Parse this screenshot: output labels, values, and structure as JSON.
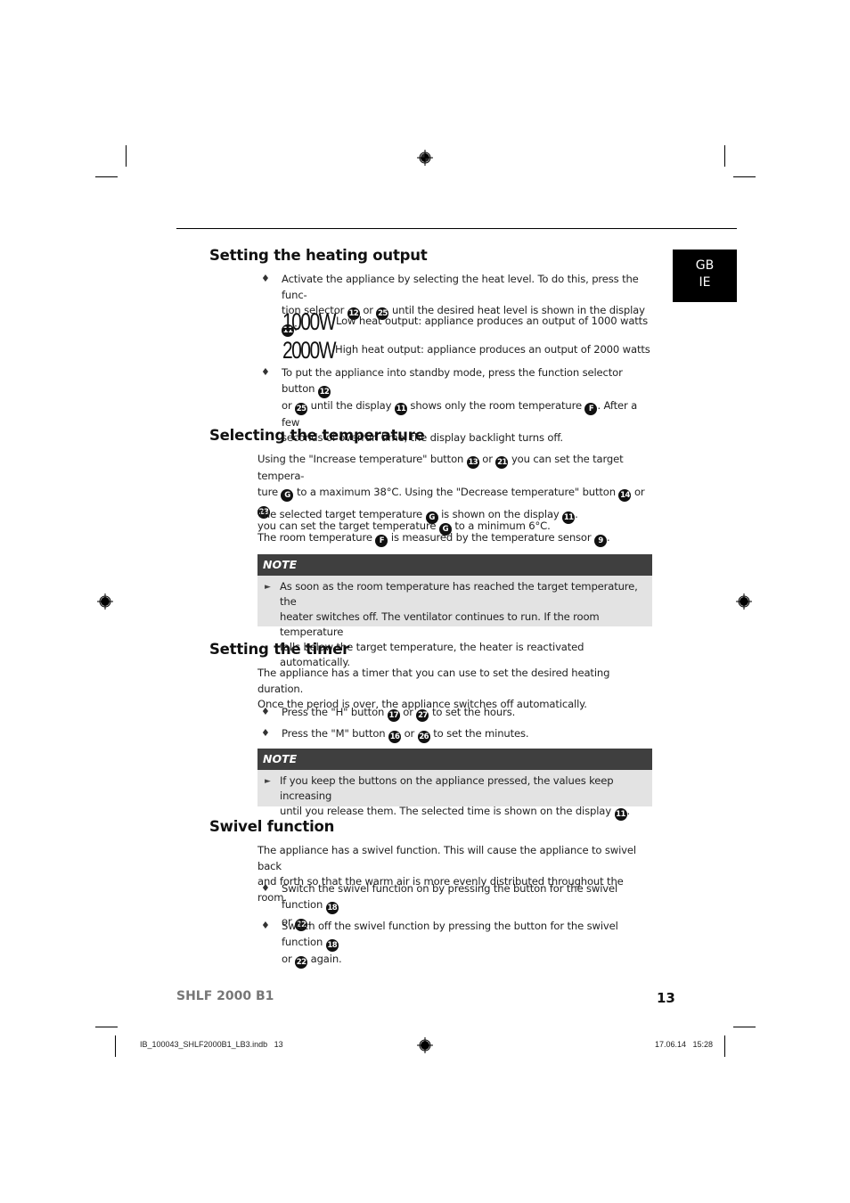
{
  "language_tab": {
    "line1": "GB",
    "line2": "IE"
  },
  "sections": {
    "heating": {
      "title": "Setting the heating output",
      "b1_a": "Activate the appliance by selecting the heat level. To do this, press the func-",
      "b1_b1": "tion selector ",
      "b1_c1": "12",
      "b1_b2": " or ",
      "b1_c2": "25",
      "b1_b3": " until the desired heat level is shown in the display ",
      "b1_c3": "11",
      "b1_b4": ":",
      "levels": [
        {
          "display": "1000W",
          "desc": "Low heat output: appliance produces an output of 1000 watts"
        },
        {
          "display": "2000W",
          "desc": "High heat output: appliance produces an output of 2000 watts"
        }
      ],
      "b2_a1": "To put the appliance into standby mode, press the function selector button ",
      "b2_c1": "12",
      "b2_b1": "or ",
      "b2_c2": "25",
      "b2_b2": " until the display ",
      "b2_c3": "11",
      "b2_b3": " shows only the room temperature ",
      "b2_c4": "F",
      "b2_b4": ". After a few",
      "b2_c": "seconds of overrun time, the display backlight turns off."
    },
    "temperature": {
      "title": "Selecting the temperature",
      "l1a": "Using the \"Increase temperature\" button ",
      "l1c1": "13",
      "l1b": " or ",
      "l1c2": "21",
      "l1d": " you can set the target tempera-",
      "l2a": "ture ",
      "l2c1": "G",
      "l2b": " to a maximum 38°C. Using the \"Decrease temperature\" button ",
      "l2c2": "14",
      "l2d": " or ",
      "l2c3": "23",
      "l3a": "you can set the target temperature ",
      "l3c1": "G",
      "l3b": " to a minimum 6°C.",
      "p2a": "The selected target temperature ",
      "p2c1": "G",
      "p2b": " is shown on the display ",
      "p2c2": "11",
      "p2d": ".",
      "p3a": "The room temperature ",
      "p3c1": "F",
      "p3b": " is measured by the temperature sensor ",
      "p3c2": "9",
      "p3d": ".",
      "note_label": "NOTE",
      "note_l1": "As soon as the room temperature has reached the target temperature, the",
      "note_l2": "heater switches off. The ventilator continues to run. If the room temperature",
      "note_l3": "falls below the target temperature, the heater is reactivated automatically."
    },
    "timer": {
      "title": "Setting the timer",
      "p1": "The appliance has a timer that you can use to set the desired heating duration.",
      "p2": "Once the period is over, the appliance switches off automatically.",
      "b1a": "Press the \"H\" button ",
      "b1c1": "17",
      "b1b": " or ",
      "b1c2": "27",
      "b1d": " to set the hours.",
      "b2a": "Press the \"M\" button ",
      "b2c1": "16",
      "b2b": " or ",
      "b2c2": "26",
      "b2d": " to set the minutes.",
      "note_label": "NOTE",
      "note_l1": "If you keep the buttons on the appliance pressed, the values keep increasing",
      "note_l2a": "until you release them. The selected time is shown on the display ",
      "note_c1": "11",
      "note_l2b": "."
    },
    "swivel": {
      "title": "Swivel function",
      "p1": "The appliance has a swivel function. This will cause the appliance to swivel back",
      "p2": "and forth so that the warm air is more evenly distributed throughout the room.",
      "b1a": "Switch the swivel function on by pressing the button for the swivel function ",
      "b1c1": "18",
      "b1b": "or ",
      "b1c2": "22",
      "b1d": ".",
      "b2a": "Switch off the swivel function by pressing the button for the swivel function ",
      "b2c1": "18",
      "b2b": "or ",
      "b2c2": "22",
      "b2d": " again."
    }
  },
  "footer": {
    "model": "SHLF 2000 B1",
    "page_number": "13",
    "slug_file": "IB_100043_SHLF2000B1_LB3.indb   13",
    "slug_date": "17.06.14   15:28"
  },
  "bullet_glyph": "♦",
  "note_arrow_glyph": "►"
}
